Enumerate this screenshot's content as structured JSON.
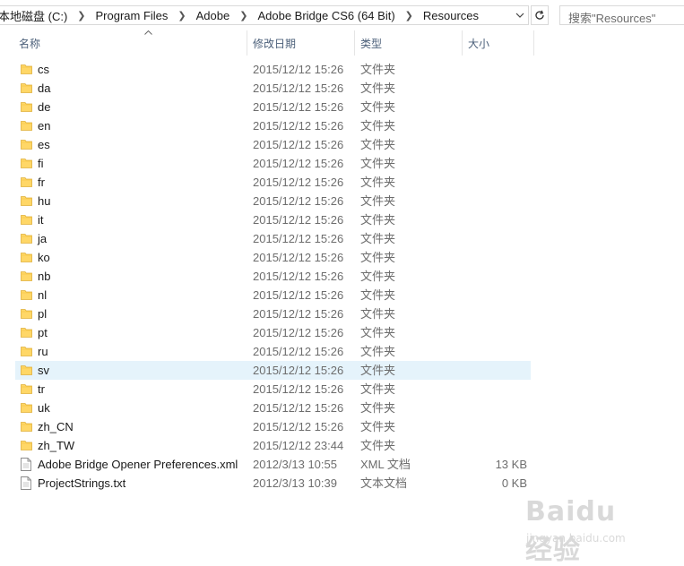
{
  "address": {
    "crumbs": [
      "本地磁盘 (C:)",
      "Program Files",
      "Adobe",
      "Adobe Bridge CS6 (64 Bit)",
      "Resources"
    ]
  },
  "search": {
    "placeholder": "搜索\"Resources\""
  },
  "columns": {
    "name": "名称",
    "date": "修改日期",
    "type": "类型",
    "size": "大小"
  },
  "rows": [
    {
      "name": "cs",
      "date": "2015/12/12 15:26",
      "type": "文件夹",
      "size": "",
      "icon": "folder-icon"
    },
    {
      "name": "da",
      "date": "2015/12/12 15:26",
      "type": "文件夹",
      "size": "",
      "icon": "folder-icon"
    },
    {
      "name": "de",
      "date": "2015/12/12 15:26",
      "type": "文件夹",
      "size": "",
      "icon": "folder-icon"
    },
    {
      "name": "en",
      "date": "2015/12/12 15:26",
      "type": "文件夹",
      "size": "",
      "icon": "folder-icon"
    },
    {
      "name": "es",
      "date": "2015/12/12 15:26",
      "type": "文件夹",
      "size": "",
      "icon": "folder-icon"
    },
    {
      "name": "fi",
      "date": "2015/12/12 15:26",
      "type": "文件夹",
      "size": "",
      "icon": "folder-icon"
    },
    {
      "name": "fr",
      "date": "2015/12/12 15:26",
      "type": "文件夹",
      "size": "",
      "icon": "folder-icon"
    },
    {
      "name": "hu",
      "date": "2015/12/12 15:26",
      "type": "文件夹",
      "size": "",
      "icon": "folder-icon"
    },
    {
      "name": "it",
      "date": "2015/12/12 15:26",
      "type": "文件夹",
      "size": "",
      "icon": "folder-icon"
    },
    {
      "name": "ja",
      "date": "2015/12/12 15:26",
      "type": "文件夹",
      "size": "",
      "icon": "folder-icon"
    },
    {
      "name": "ko",
      "date": "2015/12/12 15:26",
      "type": "文件夹",
      "size": "",
      "icon": "folder-icon"
    },
    {
      "name": "nb",
      "date": "2015/12/12 15:26",
      "type": "文件夹",
      "size": "",
      "icon": "folder-icon"
    },
    {
      "name": "nl",
      "date": "2015/12/12 15:26",
      "type": "文件夹",
      "size": "",
      "icon": "folder-icon"
    },
    {
      "name": "pl",
      "date": "2015/12/12 15:26",
      "type": "文件夹",
      "size": "",
      "icon": "folder-icon"
    },
    {
      "name": "pt",
      "date": "2015/12/12 15:26",
      "type": "文件夹",
      "size": "",
      "icon": "folder-icon"
    },
    {
      "name": "ru",
      "date": "2015/12/12 15:26",
      "type": "文件夹",
      "size": "",
      "icon": "folder-icon"
    },
    {
      "name": "sv",
      "date": "2015/12/12 15:26",
      "type": "文件夹",
      "size": "",
      "icon": "folder-icon",
      "selected": true
    },
    {
      "name": "tr",
      "date": "2015/12/12 15:26",
      "type": "文件夹",
      "size": "",
      "icon": "folder-icon"
    },
    {
      "name": "uk",
      "date": "2015/12/12 15:26",
      "type": "文件夹",
      "size": "",
      "icon": "folder-icon"
    },
    {
      "name": "zh_CN",
      "date": "2015/12/12 15:26",
      "type": "文件夹",
      "size": "",
      "icon": "folder-icon"
    },
    {
      "name": "zh_TW",
      "date": "2015/12/12 23:44",
      "type": "文件夹",
      "size": "",
      "icon": "folder-icon"
    },
    {
      "name": "Adobe Bridge Opener Preferences.xml",
      "date": "2012/3/13 10:55",
      "type": "XML 文档",
      "size": "13 KB",
      "icon": "xml-file-icon"
    },
    {
      "name": "ProjectStrings.txt",
      "date": "2012/3/13 10:39",
      "type": "文本文档",
      "size": "0 KB",
      "icon": "text-file-icon"
    }
  ],
  "watermark": {
    "main": "Baidu 经验",
    "sub": "jingyan.baidu.com"
  },
  "colors": {
    "folder": "#ffd767",
    "selection": "#e5f3fb",
    "header_text": "#4c607a"
  }
}
